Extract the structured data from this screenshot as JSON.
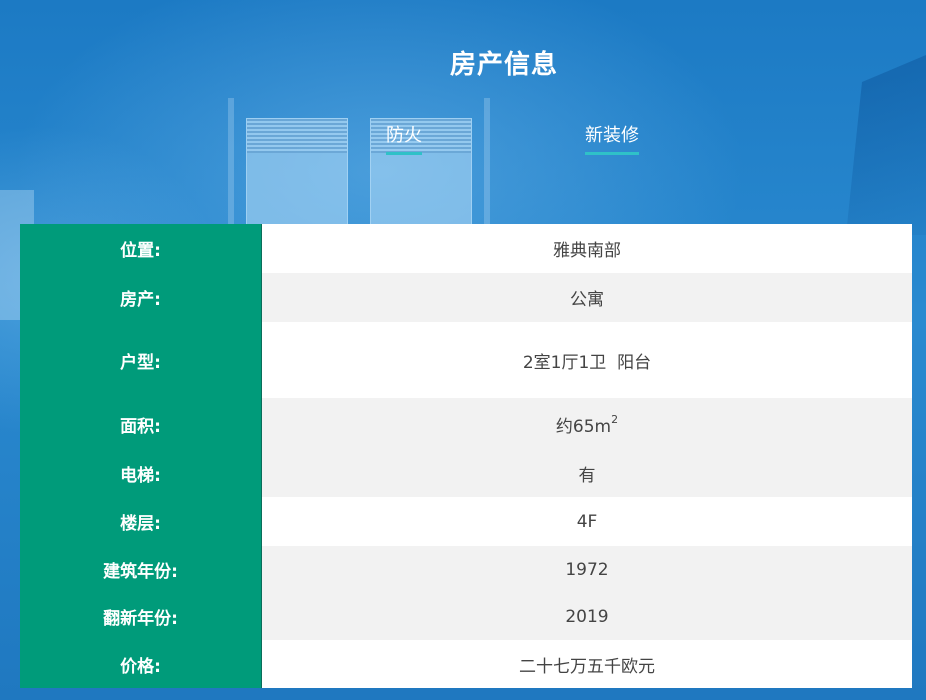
{
  "page": {
    "title": "房产信息",
    "tags": [
      {
        "label": "防火"
      },
      {
        "label": "新装修"
      }
    ]
  },
  "property": {
    "rows": [
      {
        "label": "位置:",
        "value": "雅典南部"
      },
      {
        "label": "房产:",
        "value": "公寓"
      },
      {
        "label": "户型:",
        "value": "2室1厅1卫  阳台"
      },
      {
        "label": "面积:",
        "value": "约65m",
        "value_sup": "2"
      },
      {
        "label": "电梯:",
        "value": "有"
      },
      {
        "label": "楼层:",
        "value": "4F"
      },
      {
        "label": "建筑年份:",
        "value": "1972"
      },
      {
        "label": "翻新年份:",
        "value": "2019"
      },
      {
        "label": "价格:",
        "value": "二十七万五千欧元"
      }
    ]
  },
  "colors": {
    "label_background": "#009b7a",
    "tag_underline": "#2fc1c8",
    "background_blue": "#1f7fc6"
  }
}
